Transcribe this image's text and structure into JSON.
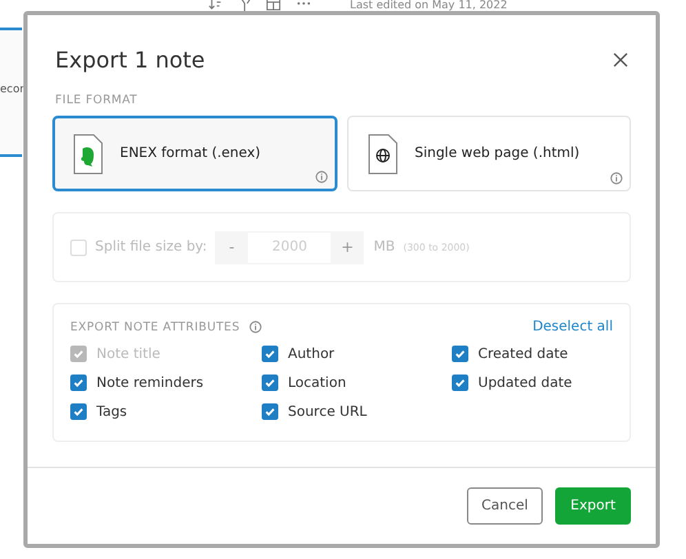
{
  "background": {
    "last_edited": "Last edited on May 11, 2022",
    "side_label": "ecor"
  },
  "dialog": {
    "title": "Export 1 note",
    "format_label": "FILE FORMAT",
    "formats": [
      {
        "kind": "enex",
        "label": "ENEX format (.enex)",
        "selected": true
      },
      {
        "kind": "html",
        "label": "Single web page (.html)",
        "selected": false
      }
    ],
    "split": {
      "label": "Split file size by:",
      "checked": false,
      "disabled": true,
      "minus": "-",
      "value": "2000",
      "plus": "+",
      "unit": "MB",
      "range": "(300 to 2000)"
    },
    "attributes": {
      "title": "EXPORT NOTE ATTRIBUTES",
      "action": "Deselect all",
      "items": [
        {
          "label": "Note title",
          "checked": true,
          "disabled": true
        },
        {
          "label": "Author",
          "checked": true,
          "disabled": false
        },
        {
          "label": "Created date",
          "checked": true,
          "disabled": false
        },
        {
          "label": "Note reminders",
          "checked": true,
          "disabled": false
        },
        {
          "label": "Location",
          "checked": true,
          "disabled": false
        },
        {
          "label": "Updated date",
          "checked": true,
          "disabled": false
        },
        {
          "label": "Tags",
          "checked": true,
          "disabled": false
        },
        {
          "label": "Source URL",
          "checked": true,
          "disabled": false
        }
      ]
    },
    "buttons": [
      {
        "kind": "secondary",
        "label": "Cancel"
      },
      {
        "kind": "primary",
        "label": "Export"
      }
    ]
  }
}
